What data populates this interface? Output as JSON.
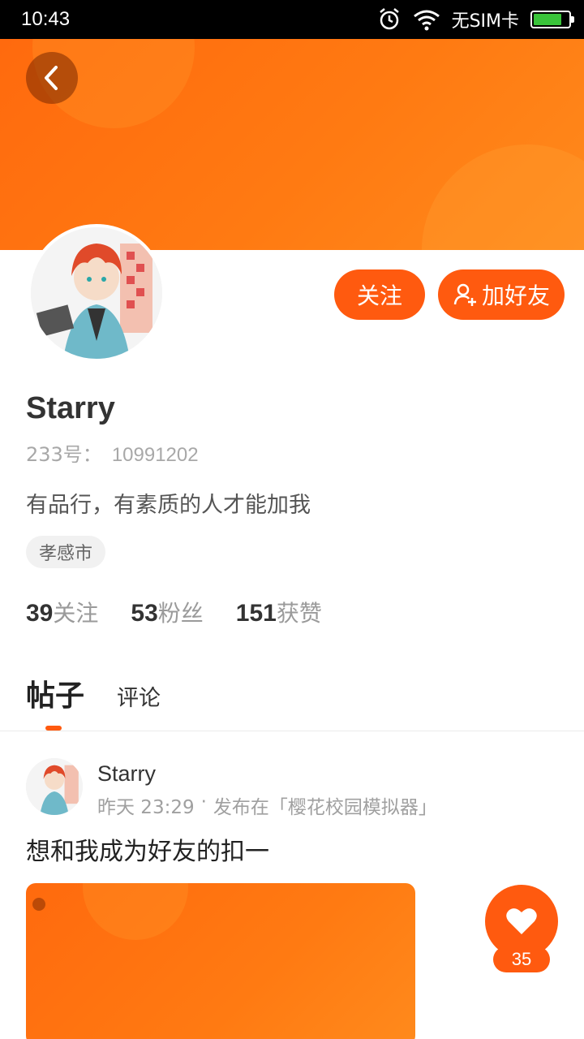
{
  "status_bar": {
    "time": "10:43",
    "carrier": "无SIM卡",
    "icons": [
      "alarm-icon",
      "wifi-icon",
      "battery-icon"
    ]
  },
  "header": {
    "back_icon": "chevron-left-icon"
  },
  "profile": {
    "name": "Starry",
    "id_label": "233号：",
    "id_value": "10991202",
    "bio": "有品行，有素质的人才能加我",
    "location": "孝感市",
    "follow_label": "关注",
    "add_friend_label": "加好友",
    "stats": [
      {
        "num": "39",
        "label": "关注"
      },
      {
        "num": "53",
        "label": "粉丝"
      },
      {
        "num": "151",
        "label": "获赞"
      }
    ]
  },
  "tabs": {
    "active": "帖子",
    "other": "评论"
  },
  "post": {
    "author": "Starry",
    "time": "昨天 23:29",
    "dot": "·",
    "published_in": "发布在「樱花校园模拟器」",
    "text": "想和我成为好友的扣一",
    "likes": "35"
  },
  "colors": {
    "accent": "#ff5a0f",
    "banner": "#ff7a12"
  }
}
